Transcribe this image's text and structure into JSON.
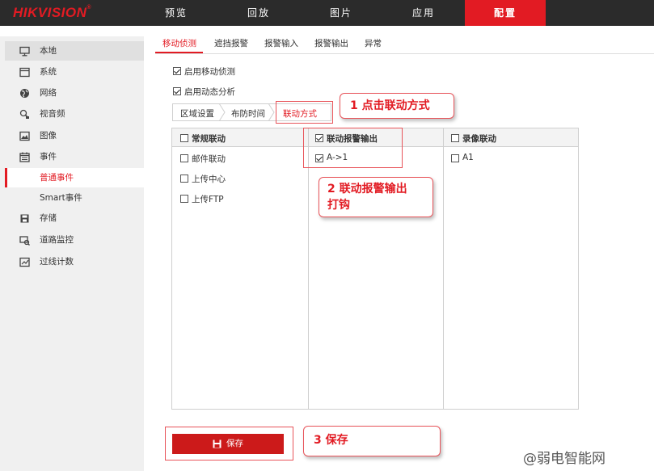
{
  "brand": {
    "part1": "HIK",
    "part2": "VISION",
    "reg": "®"
  },
  "nav": [
    "预览",
    "回放",
    "图片",
    "应用",
    "配置"
  ],
  "sidebar": {
    "items": [
      {
        "label": "本地",
        "icon": "monitor-icon"
      },
      {
        "label": "系统",
        "icon": "system-icon"
      },
      {
        "label": "网络",
        "icon": "globe-icon"
      },
      {
        "label": "视音频",
        "icon": "av-icon"
      },
      {
        "label": "图像",
        "icon": "image-icon"
      },
      {
        "label": "事件",
        "icon": "calendar-icon"
      },
      {
        "label": "普通事件"
      },
      {
        "label": "Smart事件"
      },
      {
        "label": "存储",
        "icon": "storage-icon"
      },
      {
        "label": "道路监控",
        "icon": "road-monitor-icon"
      },
      {
        "label": "过线计数",
        "icon": "line-count-icon"
      }
    ]
  },
  "tabs": [
    "移动侦测",
    "遮挡报警",
    "报警输入",
    "报警输出",
    "异常"
  ],
  "options": {
    "motion_detect": "启用移动侦测",
    "dynamic_analysis": "启用动态分析"
  },
  "breadcrumbs": [
    "区域设置",
    "布防时间",
    "联动方式"
  ],
  "columns": {
    "normal": {
      "header": "常规联动",
      "items": [
        "邮件联动",
        "上传中心",
        "上传FTP"
      ]
    },
    "alarm_out": {
      "header": "联动报警输出",
      "items": [
        "A->1"
      ]
    },
    "record": {
      "header": "录像联动",
      "items": [
        "A1"
      ]
    }
  },
  "save_label": "保存",
  "annotations": {
    "step1": "1 点击联动方式",
    "step2_line1": "2 联动报警输出",
    "step2_line2": "打钩",
    "step3": "3 保存"
  },
  "watermark": "@弱电智能网",
  "colors": {
    "accent": "#e21b23",
    "topbar": "#2b2b2b",
    "sidebar": "#f0f0f0"
  }
}
